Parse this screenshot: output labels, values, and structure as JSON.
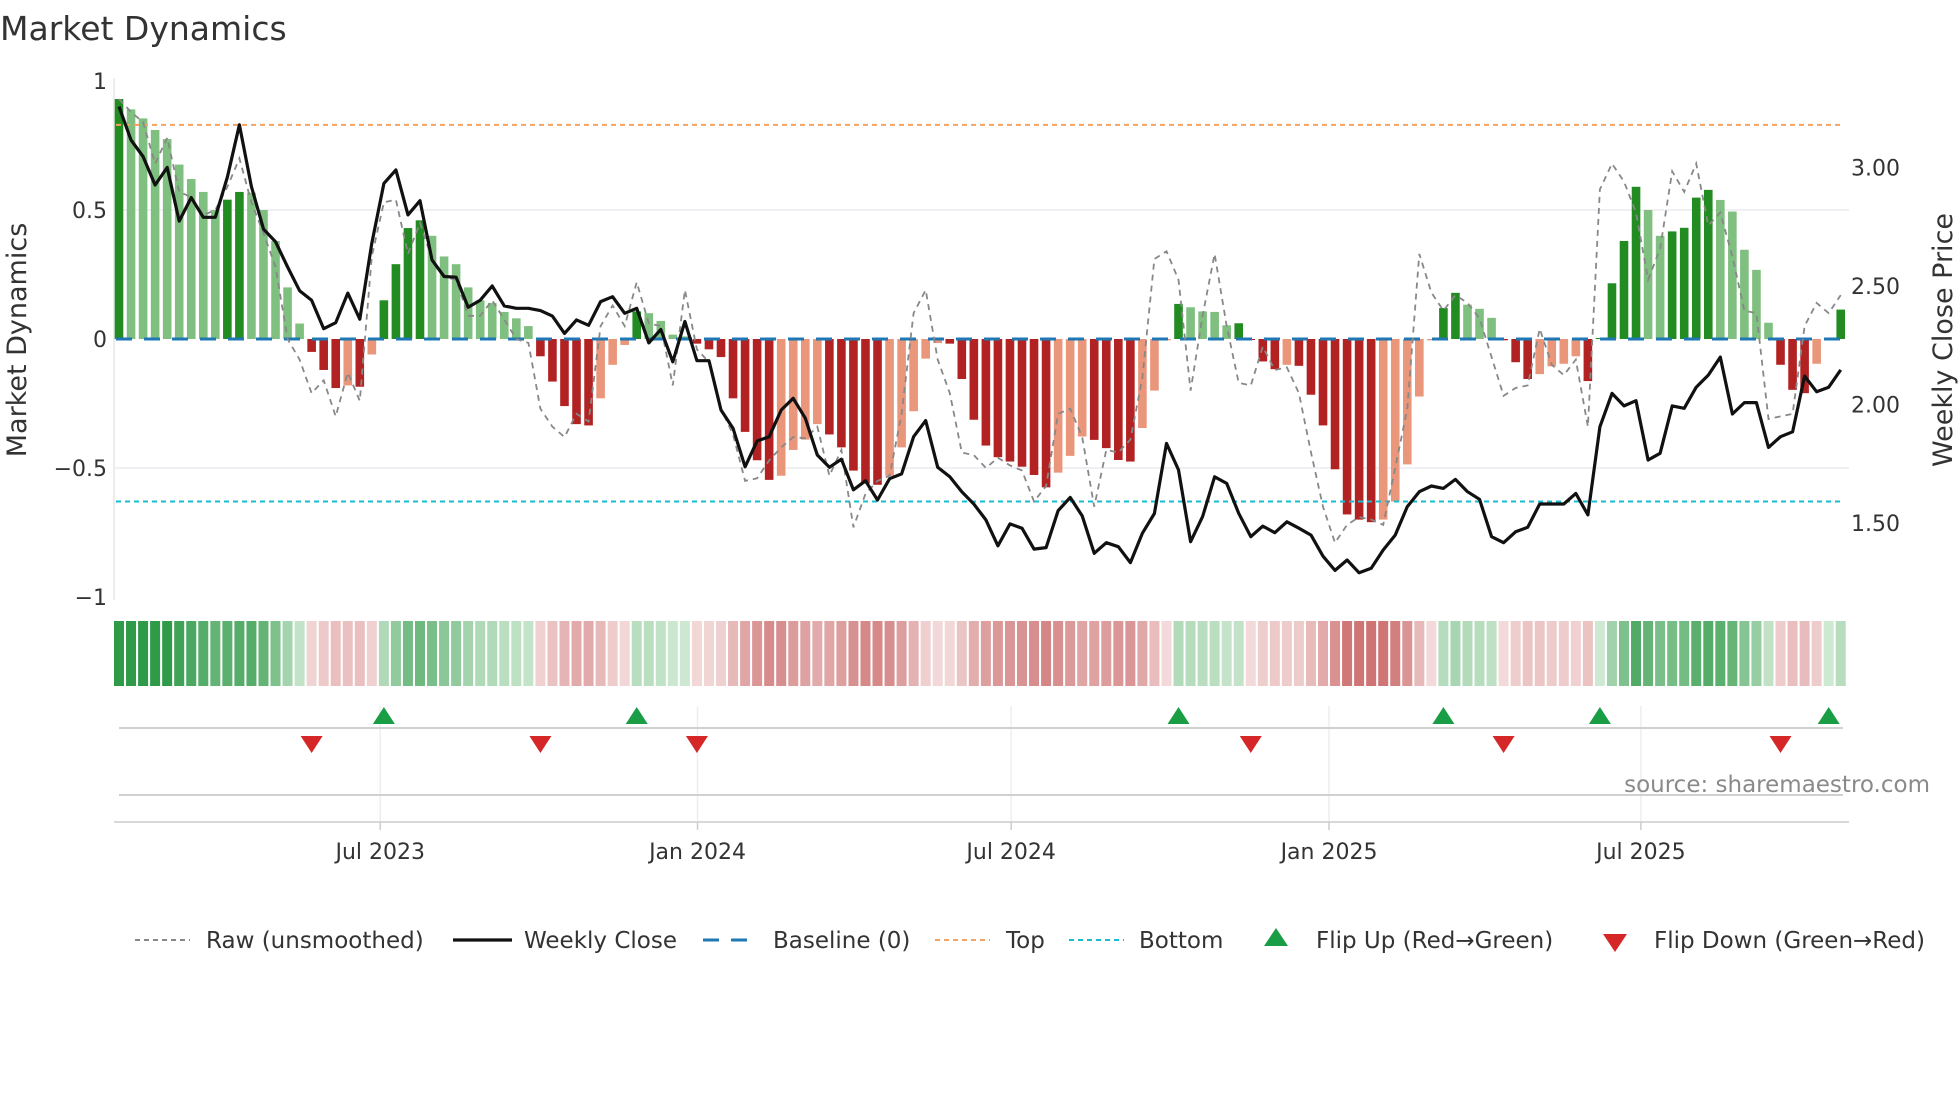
{
  "title": "Market Dynamics",
  "source": "source: sharemaestro.com",
  "colors": {
    "green_strong": "#228b22",
    "green_weak": "#7fbf7f",
    "red_strong": "#b22222",
    "red_weak": "#e9967a",
    "raw": "#888888",
    "close": "#111111",
    "baseline": "#1f77b4",
    "top": "#f4a460",
    "bottom": "#17becf",
    "flip_up": "#1a9e45",
    "flip_down": "#d62728"
  },
  "chart_data": {
    "type": "bar",
    "title": "Market Dynamics",
    "ylabel": "Market Dynamics",
    "y2label": "Weekly Close Price",
    "ylim": [
      -1,
      1
    ],
    "y2lim": [
      1.18,
      3.36
    ],
    "grid": true,
    "legend_position": "bottom",
    "yticks": [
      {
        "v": 1,
        "label": "1"
      },
      {
        "v": 0.5,
        "label": "0.5"
      },
      {
        "v": 0,
        "label": "0"
      },
      {
        "v": -0.5,
        "label": "−0.5"
      },
      {
        "v": -1,
        "label": "−1"
      }
    ],
    "y2ticks": [
      {
        "v": 3.0,
        "label": "3.00"
      },
      {
        "v": 2.5,
        "label": "2.50"
      },
      {
        "v": 2.0,
        "label": "2.00"
      },
      {
        "v": 1.5,
        "label": "1.50"
      }
    ],
    "xticks": [
      {
        "x": 21.7,
        "label": "Jul 2023"
      },
      {
        "x": 48.05,
        "label": "Jan 2024"
      },
      {
        "x": 74.1,
        "label": "Jul 2024"
      },
      {
        "x": 100.5,
        "label": "Jan 2025"
      },
      {
        "x": 126.4,
        "label": "Jul 2025"
      }
    ],
    "top": 0.83,
    "bottom": -0.63,
    "baseline": 0,
    "momentum": [
      0.93,
      0.89,
      0.855,
      0.81,
      0.775,
      0.676,
      0.62,
      0.57,
      0.5,
      0.54,
      0.57,
      0.567,
      0.5,
      0.38,
      0.2,
      0.06,
      -0.05,
      -0.12,
      -0.19,
      -0.18,
      -0.185,
      -0.06,
      0.15,
      0.29,
      0.43,
      0.46,
      0.4,
      0.32,
      0.29,
      0.2,
      0.15,
      0.14,
      0.105,
      0.08,
      0.05,
      -0.067,
      -0.165,
      -0.26,
      -0.33,
      -0.335,
      -0.23,
      -0.1,
      -0.023,
      0.107,
      0.1,
      0.07,
      0.017,
      0.01,
      -0.018,
      -0.04,
      -0.07,
      -0.23,
      -0.36,
      -0.47,
      -0.546,
      -0.53,
      -0.43,
      -0.39,
      -0.33,
      -0.37,
      -0.42,
      -0.51,
      -0.56,
      -0.565,
      -0.53,
      -0.42,
      -0.28,
      -0.076,
      -0.016,
      -0.018,
      -0.155,
      -0.313,
      -0.413,
      -0.458,
      -0.475,
      -0.495,
      -0.527,
      -0.575,
      -0.518,
      -0.453,
      -0.378,
      -0.391,
      -0.423,
      -0.469,
      -0.475,
      -0.345,
      -0.2,
      -0.005,
      0.136,
      0.123,
      0.107,
      0.105,
      0.053,
      0.061,
      -0.004,
      -0.087,
      -0.117,
      -0.1,
      -0.104,
      -0.216,
      -0.335,
      -0.505,
      -0.68,
      -0.7,
      -0.71,
      -0.7,
      -0.63,
      -0.486,
      -0.223,
      -0.005,
      0.12,
      0.179,
      0.133,
      0.117,
      0.082,
      -0.005,
      -0.09,
      -0.155,
      -0.136,
      -0.106,
      -0.096,
      -0.067,
      -0.163,
      0.004,
      0.216,
      0.38,
      0.59,
      0.5,
      0.4,
      0.417,
      0.431,
      0.548,
      0.578,
      0.539,
      0.494,
      0.346,
      0.268,
      0.063,
      -0.1,
      -0.197,
      -0.21,
      -0.096,
      0.003,
      0.114
    ],
    "raw": [
      0.93,
      0.88,
      0.84,
      0.68,
      0.78,
      0.57,
      0.55,
      0.48,
      0.5,
      0.59,
      0.7,
      0.53,
      0.41,
      0.28,
      0.0,
      -0.08,
      -0.21,
      -0.16,
      -0.3,
      -0.13,
      -0.24,
      0.32,
      0.53,
      0.54,
      0.33,
      0.45,
      0.31,
      0.24,
      0.23,
      0.09,
      0.09,
      0.15,
      0.075,
      0.0,
      -0.015,
      -0.27,
      -0.34,
      -0.38,
      -0.29,
      -0.32,
      0.05,
      0.13,
      0.05,
      0.22,
      0.06,
      0.05,
      -0.18,
      0.19,
      -0.04,
      -0.09,
      -0.27,
      -0.37,
      -0.55,
      -0.54,
      -0.47,
      -0.42,
      -0.38,
      -0.385,
      -0.34,
      -0.53,
      -0.43,
      -0.73,
      -0.6,
      -0.55,
      -0.53,
      -0.29,
      0.1,
      0.19,
      -0.08,
      -0.21,
      -0.44,
      -0.45,
      -0.5,
      -0.46,
      -0.49,
      -0.51,
      -0.63,
      -0.57,
      -0.29,
      -0.27,
      -0.38,
      -0.65,
      -0.43,
      -0.44,
      -0.39,
      -0.15,
      0.31,
      0.34,
      0.23,
      -0.2,
      0.09,
      0.33,
      0.05,
      -0.17,
      -0.18,
      -0.03,
      -0.12,
      -0.11,
      -0.21,
      -0.44,
      -0.65,
      -0.79,
      -0.72,
      -0.69,
      -0.7,
      -0.72,
      -0.5,
      -0.27,
      0.33,
      0.18,
      0.11,
      0.17,
      0.14,
      0.08,
      -0.07,
      -0.22,
      -0.19,
      -0.18,
      0.04,
      -0.1,
      -0.14,
      -0.08,
      -0.34,
      0.58,
      0.68,
      0.61,
      0.49,
      0.23,
      0.35,
      0.65,
      0.57,
      0.68,
      0.44,
      0.49,
      0.32,
      0.11,
      0.1,
      -0.31,
      -0.3,
      -0.29,
      0.05,
      0.14,
      0.1,
      0.17
    ],
    "close": [
      3.257,
      3.116,
      3.046,
      2.926,
      3.0,
      2.774,
      2.873,
      2.79,
      2.79,
      2.96,
      3.18,
      2.92,
      2.74,
      2.687,
      2.58,
      2.48,
      2.44,
      2.32,
      2.345,
      2.47,
      2.36,
      2.68,
      2.933,
      2.99,
      2.8,
      2.86,
      2.61,
      2.54,
      2.537,
      2.41,
      2.44,
      2.5,
      2.416,
      2.406,
      2.406,
      2.396,
      2.373,
      2.3,
      2.357,
      2.334,
      2.434,
      2.455,
      2.385,
      2.406,
      2.26,
      2.317,
      2.18,
      2.35,
      2.185,
      2.185,
      1.977,
      1.9,
      1.737,
      1.846,
      1.864,
      1.977,
      2.026,
      1.942,
      1.787,
      1.735,
      1.769,
      1.64,
      1.678,
      1.597,
      1.687,
      1.707,
      1.864,
      1.932,
      1.735,
      1.695,
      1.632,
      1.58,
      1.513,
      1.404,
      1.496,
      1.478,
      1.39,
      1.396,
      1.552,
      1.608,
      1.53,
      1.372,
      1.417,
      1.4,
      1.333,
      1.457,
      1.54,
      1.836,
      1.724,
      1.421,
      1.527,
      1.695,
      1.667,
      1.541,
      1.442,
      1.487,
      1.459,
      1.505,
      1.478,
      1.449,
      1.36,
      1.3,
      1.344,
      1.29,
      1.309,
      1.386,
      1.449,
      1.569,
      1.632,
      1.656,
      1.646,
      1.684,
      1.632,
      1.6,
      1.442,
      1.417,
      1.463,
      1.482,
      1.58,
      1.58,
      1.58,
      1.625,
      1.534,
      1.906,
      2.047,
      1.994,
      2.016,
      1.766,
      1.794,
      1.994,
      1.984,
      2.073,
      2.124,
      2.2,
      1.96,
      2.008,
      2.008,
      1.819,
      1.864,
      1.885,
      2.12,
      2.054,
      2.073,
      2.146
    ],
    "flip_up": [
      22,
      43,
      88,
      110,
      123,
      142
    ],
    "flip_down": [
      16,
      35,
      48,
      94,
      115,
      138
    ],
    "legend": {
      "raw": "Raw (unsmoothed)",
      "close": "Weekly Close",
      "baseline": "Baseline (0)",
      "top": "Top",
      "bottom": "Bottom",
      "flip_up": "Flip Up (Red→Green)",
      "flip_down": "Flip Down (Green→Red)"
    }
  }
}
